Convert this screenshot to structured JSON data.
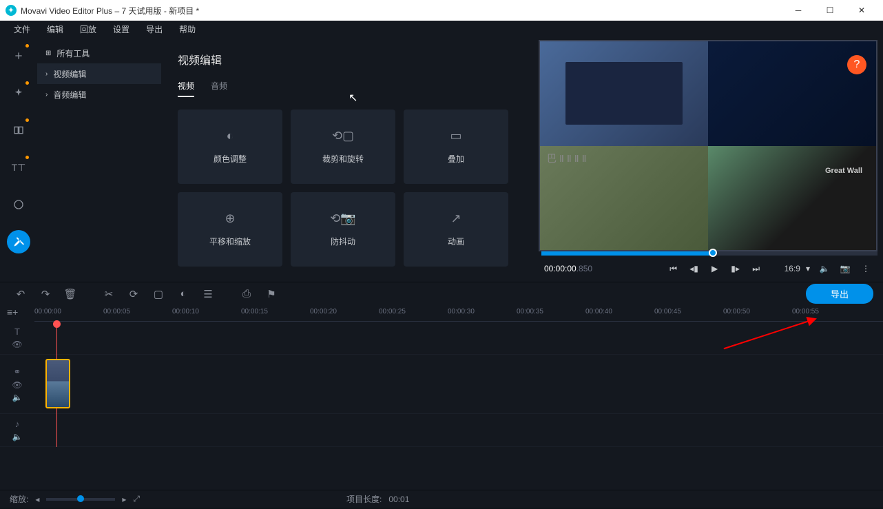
{
  "window": {
    "title": "Movavi Video Editor Plus – 7 天试用版 - 新项目 *"
  },
  "menu": {
    "file": "文件",
    "edit": "编辑",
    "playback": "回放",
    "settings": "设置",
    "export": "导出",
    "help": "帮助"
  },
  "sidepanel": {
    "all_tools": "所有工具",
    "video_edit": "视频编辑",
    "audio_edit": "音频编辑"
  },
  "center": {
    "title": "视频编辑",
    "tab_video": "视频",
    "tab_audio": "音频",
    "cards": {
      "color": "颜色调整",
      "crop": "裁剪和旋转",
      "overlay": "叠加",
      "pan": "平移和缩放",
      "stabilize": "防抖动",
      "animate": "动画"
    }
  },
  "preview": {
    "timecode": "00:00:00",
    "timecode_ms": ".850",
    "aspect": "16:9"
  },
  "toolbar": {
    "export": "导出"
  },
  "ruler": [
    "00:00:00",
    "00:00:05",
    "00:00:10",
    "00:00:15",
    "00:00:20",
    "00:00:25",
    "00:00:30",
    "00:00:35",
    "00:00:40",
    "00:00:45",
    "00:00:50",
    "00:00:55"
  ],
  "footer": {
    "zoom": "缩放:",
    "length_label": "项目长度:",
    "length_val": "00:01"
  }
}
